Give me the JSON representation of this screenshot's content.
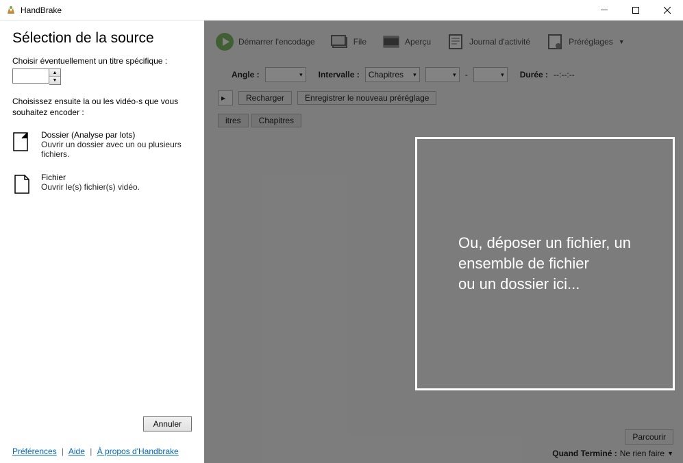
{
  "window": {
    "title": "HandBrake",
    "min": "—",
    "max": "▢",
    "close": "✕"
  },
  "sidebar": {
    "heading": "Sélection de la source",
    "choose_title_label": "Choisir éventuellement un titre spécifique :",
    "title_value": "",
    "instruction": "Choisissez ensuite la ou les vidéo·s que vous souhaitez encoder :",
    "folder": {
      "head": "Dossier (Analyse par lots)",
      "sub": "Ouvrir un dossier avec un ou plusieurs fichiers."
    },
    "file": {
      "head": "Fichier",
      "sub": "Ouvrir le(s) fichier(s) vidéo."
    },
    "cancel": "Annuler",
    "links": {
      "prefs": "Préférences",
      "help": "Aide",
      "about": "À propos d'Handbrake"
    }
  },
  "toolbar": {
    "start": "Démarrer l'encodage",
    "queue": "File",
    "preview": "Aperçu",
    "activity": "Journal d'activité",
    "presets": "Préréglages"
  },
  "form": {
    "angle_label": "Angle :",
    "range_label": "Intervalle :",
    "range_mode": "Chapitres",
    "range_sep": "-",
    "duration_label": "Durée :",
    "duration_value": "--:--:--",
    "reload": "Recharger",
    "save_preset": "Enregistrer le nouveau préréglage",
    "tab_subs": "itres",
    "tab_chapters": "Chapitres"
  },
  "dropzone": {
    "line1": "Ou, déposer un fichier, un ensemble de fichier",
    "line2": "ou un dossier ici..."
  },
  "footer": {
    "browse": "Parcourir",
    "done_label": "Quand Terminé :",
    "done_value": "Ne rien faire"
  }
}
